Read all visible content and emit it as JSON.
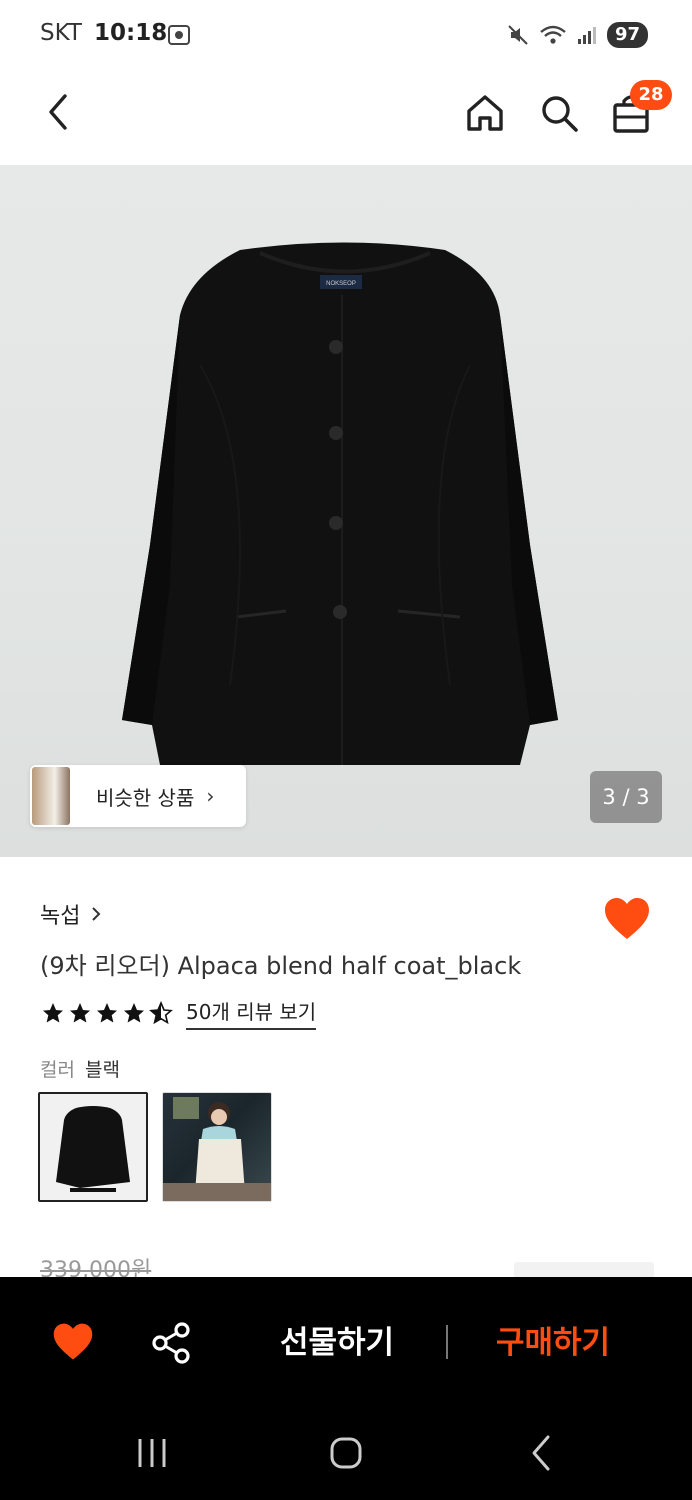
{
  "status_bar": {
    "carrier": "SKT",
    "time": "10:18",
    "battery": "97"
  },
  "header": {
    "cart_count": "28"
  },
  "hero": {
    "similar_label": "비슷한 상품",
    "pager": "3 / 3",
    "garment_label": "NOKSEOP"
  },
  "product": {
    "brand": "녹섭",
    "title": "(9차 리오더) Alpaca blend half coat_black",
    "rating": 4.5,
    "review_link": "50개 리뷰 보기",
    "color_key": "컬러",
    "color_value": "블랙",
    "original_price": "339,000원"
  },
  "actions": {
    "gift_label": "선물하기",
    "buy_label": "구매하기"
  },
  "colors": {
    "accent": "#ff4d12",
    "dark": "#000000"
  }
}
